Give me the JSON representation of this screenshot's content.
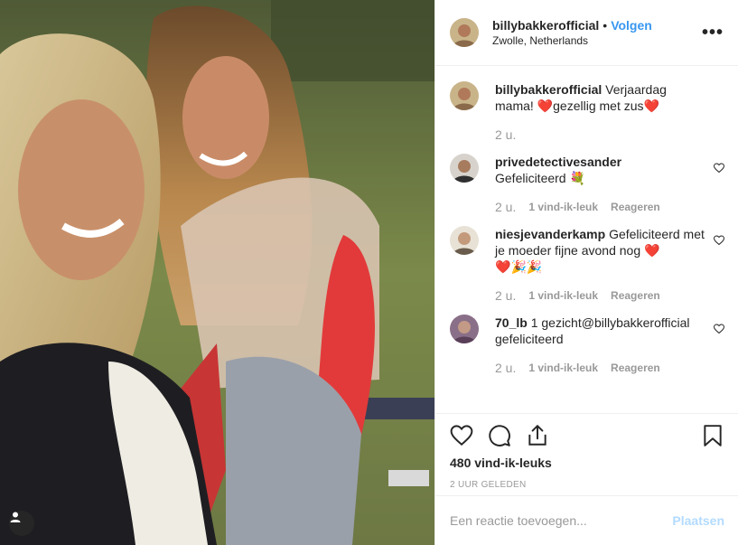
{
  "post": {
    "author": "billybakkerofficial",
    "follow_label": "Volgen",
    "separator": "•",
    "location": "Zwolle, Netherlands",
    "more_label": "•••"
  },
  "comments": [
    {
      "user": "billybakkerofficial",
      "text_parts": [
        "Verjaardag mama! ",
        "❤️",
        "gezellig met zus",
        "❤️"
      ],
      "time": "2 u.",
      "likes": "",
      "reply": ""
    },
    {
      "user": "privedetectivesander",
      "text_parts": [
        "Gefeliciteerd ",
        "💐"
      ],
      "time": "2 u.",
      "likes": "1 vind-ik-leuk",
      "reply": "Reageren"
    },
    {
      "user": "niesjevanderkamp",
      "text_parts": [
        "Gefeliciteerd met je moeder fijne avond nog ",
        "❤️",
        "❤️",
        "🎉🎉"
      ],
      "time": "2 u.",
      "likes": "1 vind-ik-leuk",
      "reply": "Reageren"
    },
    {
      "user": "70_lb",
      "text_parts": [
        "1 gezicht@billybakkerofficial gefeliciteerd"
      ],
      "time": "2 u.",
      "likes": "1 vind-ik-leuk",
      "reply": "Reageren"
    }
  ],
  "footer": {
    "likes_count": "480 vind-ik-leuks",
    "posted_ago": "2 UUR GELEDEN",
    "comment_placeholder": "Een reactie toevoegen...",
    "post_label": "Plaatsen"
  },
  "colors": {
    "link": "#3897f0",
    "muted": "#999999",
    "post_disabled": "#b3dbff",
    "heart": "#ed1c24"
  },
  "icons": [
    "like-icon",
    "comment-icon",
    "share-icon",
    "bookmark-icon",
    "user-tag-icon",
    "small-heart-icon"
  ]
}
